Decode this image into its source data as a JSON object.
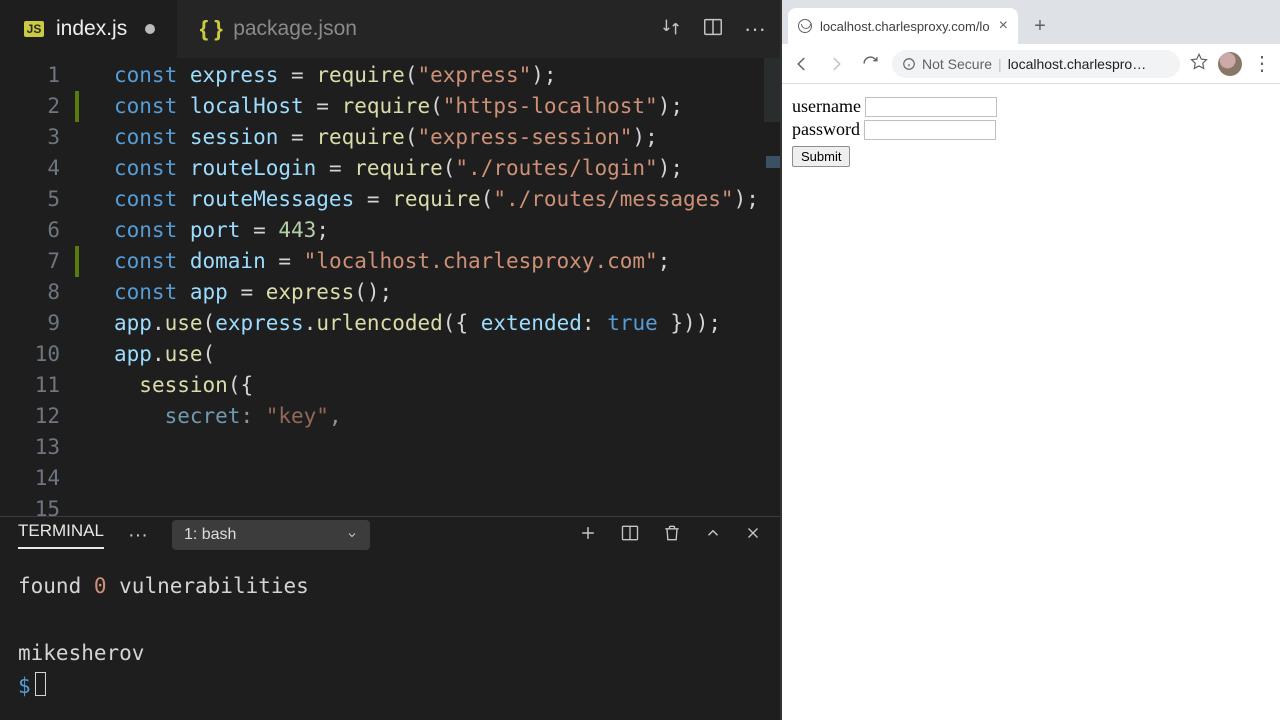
{
  "editor": {
    "tabs": [
      {
        "icon": "JS",
        "name": "index.js",
        "active": true,
        "dirty": true
      },
      {
        "icon": "{}",
        "name": "package.json",
        "active": false,
        "dirty": false
      }
    ],
    "line_numbers": [
      "1",
      "2",
      "3",
      "4",
      "5",
      "6",
      "7",
      "8",
      "9",
      "10",
      "11",
      "12",
      "13",
      "14",
      "15"
    ],
    "code": [
      {
        "t": [
          [
            "kw",
            "const "
          ],
          [
            "var",
            "express"
          ],
          [
            "punc",
            " = "
          ],
          [
            "fn",
            "require"
          ],
          [
            "punc",
            "("
          ],
          [
            "str",
            "\"express\""
          ],
          [
            "punc",
            ");"
          ]
        ]
      },
      {
        "t": [
          [
            "kw",
            "const "
          ],
          [
            "var",
            "localHost"
          ],
          [
            "punc",
            " = "
          ],
          [
            "fn",
            "require"
          ],
          [
            "punc",
            "("
          ],
          [
            "str",
            "\"https-localhost\""
          ],
          [
            "punc",
            ");"
          ]
        ]
      },
      {
        "t": [
          [
            "kw",
            "const "
          ],
          [
            "var",
            "session"
          ],
          [
            "punc",
            " = "
          ],
          [
            "fn",
            "require"
          ],
          [
            "punc",
            "("
          ],
          [
            "str",
            "\"express-session\""
          ],
          [
            "punc",
            ");"
          ]
        ]
      },
      {
        "t": [
          [
            "kw",
            "const "
          ],
          [
            "var",
            "routeLogin"
          ],
          [
            "punc",
            " = "
          ],
          [
            "fn",
            "require"
          ],
          [
            "punc",
            "("
          ],
          [
            "str",
            "\"./routes/login\""
          ],
          [
            "punc",
            ");"
          ]
        ]
      },
      {
        "t": [
          [
            "kw",
            "const "
          ],
          [
            "var",
            "routeMessages"
          ],
          [
            "punc",
            " = "
          ],
          [
            "fn",
            "require"
          ],
          [
            "punc",
            "("
          ],
          [
            "str",
            "\"./routes/messages\""
          ],
          [
            "punc",
            ");"
          ]
        ]
      },
      {
        "t": [
          [
            "punc",
            ""
          ]
        ]
      },
      {
        "t": [
          [
            "kw",
            "const "
          ],
          [
            "var",
            "port"
          ],
          [
            "punc",
            " = "
          ],
          [
            "num",
            "443"
          ],
          [
            "punc",
            ";"
          ]
        ]
      },
      {
        "t": [
          [
            "kw",
            "const "
          ],
          [
            "var",
            "domain"
          ],
          [
            "punc",
            " = "
          ],
          [
            "str",
            "\"localhost.charlesproxy.com\""
          ],
          [
            "punc",
            ";"
          ]
        ]
      },
      {
        "t": [
          [
            "punc",
            ""
          ]
        ]
      },
      {
        "t": [
          [
            "kw",
            "const "
          ],
          [
            "var",
            "app"
          ],
          [
            "punc",
            " = "
          ],
          [
            "fn",
            "express"
          ],
          [
            "punc",
            "();"
          ]
        ]
      },
      {
        "t": [
          [
            "var",
            "app"
          ],
          [
            "punc",
            "."
          ],
          [
            "fn",
            "use"
          ],
          [
            "punc",
            "("
          ],
          [
            "var",
            "express"
          ],
          [
            "punc",
            "."
          ],
          [
            "fn",
            "urlencoded"
          ],
          [
            "punc",
            "({ "
          ],
          [
            "prop",
            "extended"
          ],
          [
            "punc",
            ": "
          ],
          [
            "bool",
            "true"
          ],
          [
            "punc",
            " }));"
          ]
        ]
      },
      {
        "t": [
          [
            "punc",
            ""
          ]
        ]
      },
      {
        "t": [
          [
            "var",
            "app"
          ],
          [
            "punc",
            "."
          ],
          [
            "fn",
            "use"
          ],
          [
            "punc",
            "("
          ]
        ]
      },
      {
        "t": [
          [
            "punc",
            "  "
          ],
          [
            "fn",
            "session"
          ],
          [
            "punc",
            "({"
          ]
        ]
      },
      {
        "t": [
          [
            "punc",
            "    "
          ],
          [
            "prop",
            "secret"
          ],
          [
            "punc",
            ": "
          ],
          [
            "str",
            "\"key\""
          ],
          [
            "punc",
            ","
          ]
        ],
        "dim": true
      }
    ],
    "gutter_changes": [
      {
        "line": 2
      },
      {
        "line": 7
      }
    ]
  },
  "terminal": {
    "tab_label": "TERMINAL",
    "shell_select": "1: bash",
    "output_found": "found ",
    "output_zero": "0",
    "output_vuln": " vulnerabilities",
    "user": "mikesherov",
    "prompt": "$"
  },
  "browser": {
    "tab_title": "localhost.charlesproxy.com/lo",
    "not_secure": "Not Secure",
    "url": "localhost.charlespro…",
    "form": {
      "username_label": "username",
      "password_label": "password",
      "submit_label": "Submit"
    }
  }
}
